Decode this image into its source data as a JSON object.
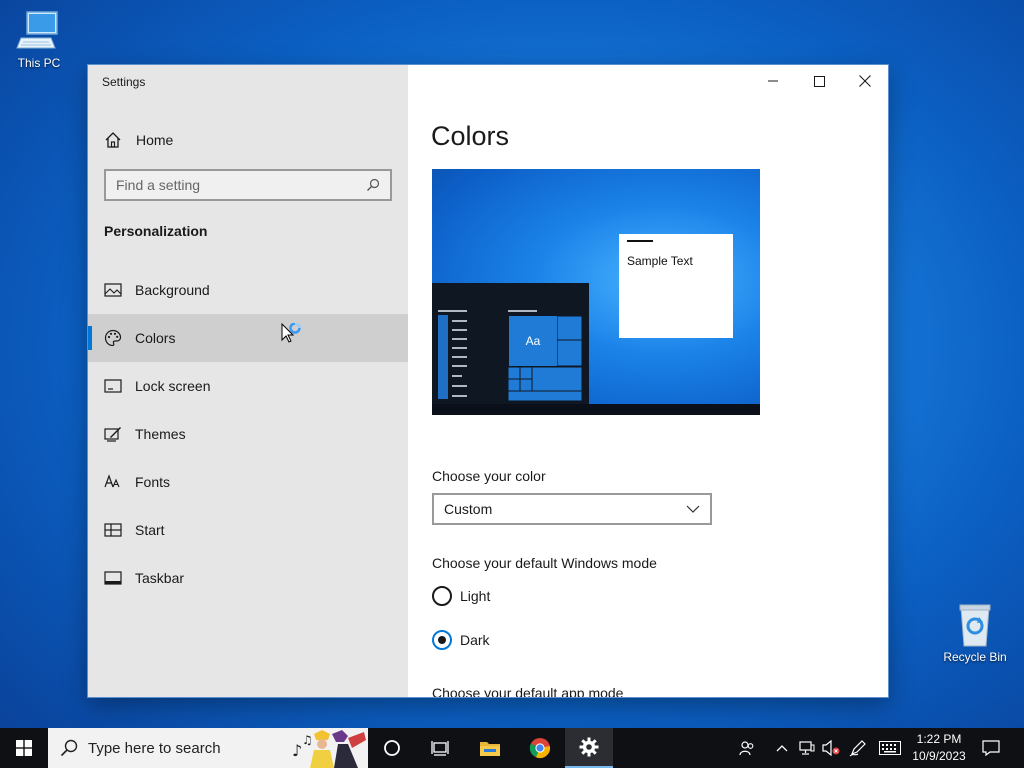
{
  "desktop": {
    "this_pc_label": "This PC",
    "recycle_bin_label": "Recycle Bin"
  },
  "window": {
    "title": "Settings",
    "controls": {
      "minimize": "minimize-icon",
      "maximize": "maximize-icon",
      "close": "close-icon"
    }
  },
  "sidebar": {
    "home_label": "Home",
    "search_placeholder": "Find a setting",
    "section_title": "Personalization",
    "items": [
      {
        "label": "Background",
        "icon": "picture-icon"
      },
      {
        "label": "Colors",
        "icon": "palette-icon",
        "active": true
      },
      {
        "label": "Lock screen",
        "icon": "lock-screen-icon"
      },
      {
        "label": "Themes",
        "icon": "themes-icon"
      },
      {
        "label": "Fonts",
        "icon": "fonts-icon"
      },
      {
        "label": "Start",
        "icon": "start-icon"
      },
      {
        "label": "Taskbar",
        "icon": "taskbar-icon"
      }
    ]
  },
  "content": {
    "title": "Colors",
    "preview": {
      "sample_text": "Sample Text",
      "tile_text": "Aa"
    },
    "choose_color_label": "Choose your color",
    "choose_color_value": "Custom",
    "windows_mode_label": "Choose your default Windows mode",
    "windows_mode_options": [
      {
        "label": "Light",
        "checked": false
      },
      {
        "label": "Dark",
        "checked": true
      }
    ],
    "app_mode_label": "Choose your default app mode"
  },
  "taskbar": {
    "search_placeholder": "Type here to search",
    "time": "1:22 PM",
    "date": "10/9/2023"
  },
  "colors": {
    "accent": "#0078d7",
    "sidebar_bg": "#e6e6e6",
    "taskbar_bg": "#0f1014"
  }
}
